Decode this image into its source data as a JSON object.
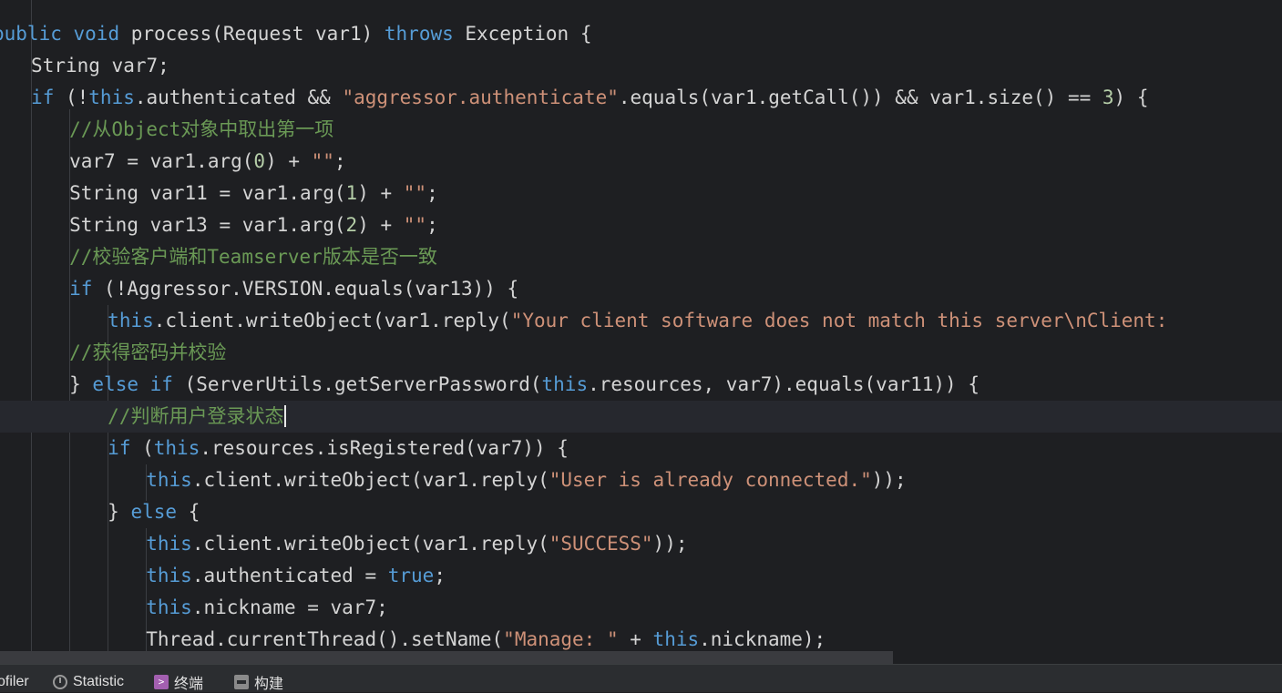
{
  "editor": {
    "lines": [
      [
        {
          "t": "public",
          "c": "kw"
        },
        {
          "t": " "
        },
        {
          "t": "void",
          "c": "kw"
        },
        {
          "t": " process(Request var1) "
        },
        {
          "t": "throws",
          "c": "kw"
        },
        {
          "t": " Exception {"
        }
      ],
      [
        {
          "t": "String var7;"
        }
      ],
      [
        {
          "t": "if",
          "c": "kw"
        },
        {
          "t": " (!"
        },
        {
          "t": "this",
          "c": "kw"
        },
        {
          "t": ".authenticated && "
        },
        {
          "t": "\"aggressor.authenticate\"",
          "c": "str"
        },
        {
          "t": ".equals(var1.getCall()) && var1.size() == "
        },
        {
          "t": "3",
          "c": "num"
        },
        {
          "t": ") {"
        }
      ],
      [
        {
          "t": "//从Object对象中取出第一项",
          "c": "cm"
        }
      ],
      [
        {
          "t": "var7 = var1.arg("
        },
        {
          "t": "0",
          "c": "num"
        },
        {
          "t": ") + "
        },
        {
          "t": "\"\"",
          "c": "str"
        },
        {
          "t": ";"
        }
      ],
      [
        {
          "t": "String var11 = var1.arg("
        },
        {
          "t": "1",
          "c": "num"
        },
        {
          "t": ") + "
        },
        {
          "t": "\"\"",
          "c": "str"
        },
        {
          "t": ";"
        }
      ],
      [
        {
          "t": "String var13 = var1.arg("
        },
        {
          "t": "2",
          "c": "num"
        },
        {
          "t": ") + "
        },
        {
          "t": "\"\"",
          "c": "str"
        },
        {
          "t": ";"
        }
      ],
      [
        {
          "t": "//校验客户端和Teamserver版本是否一致",
          "c": "cm"
        }
      ],
      [
        {
          "t": "if",
          "c": "kw"
        },
        {
          "t": " (!Aggressor.VERSION.equals(var13)) {"
        }
      ],
      [
        {
          "t": "this",
          "c": "kw"
        },
        {
          "t": ".client.writeObject(var1.reply("
        },
        {
          "t": "\"Your client software does not match this server\\nClient:",
          "c": "str"
        }
      ],
      [
        {
          "t": "//获得密码并校验",
          "c": "cm"
        }
      ],
      [
        {
          "t": "} "
        },
        {
          "t": "else",
          "c": "kw"
        },
        {
          "t": " "
        },
        {
          "t": "if",
          "c": "kw"
        },
        {
          "t": " (ServerUtils.getServerPassword("
        },
        {
          "t": "this",
          "c": "kw"
        },
        {
          "t": ".resources, var7).equals(var11)) {"
        }
      ],
      [
        {
          "t": "//判断用户登录状态",
          "c": "cm"
        }
      ],
      [
        {
          "t": "if",
          "c": "kw"
        },
        {
          "t": " ("
        },
        {
          "t": "this",
          "c": "kw"
        },
        {
          "t": ".resources.isRegistered(var7)) {"
        }
      ],
      [
        {
          "t": "this",
          "c": "kw"
        },
        {
          "t": ".client.writeObject(var1.reply("
        },
        {
          "t": "\"User is already connected.\"",
          "c": "str"
        },
        {
          "t": "));"
        }
      ],
      [
        {
          "t": "} "
        },
        {
          "t": "else",
          "c": "kw"
        },
        {
          "t": " {"
        }
      ],
      [
        {
          "t": "this",
          "c": "kw"
        },
        {
          "t": ".client.writeObject(var1.reply("
        },
        {
          "t": "\"SUCCESS\"",
          "c": "str"
        },
        {
          "t": "));"
        }
      ],
      [
        {
          "t": "this",
          "c": "kw"
        },
        {
          "t": ".authenticated = "
        },
        {
          "t": "true",
          "c": "kw"
        },
        {
          "t": ";"
        }
      ],
      [
        {
          "t": "this",
          "c": "kw"
        },
        {
          "t": ".nickname = var7;"
        }
      ],
      [
        {
          "t": "Thread.currentThread().setName("
        },
        {
          "t": "\"Manage: \"",
          "c": "str"
        },
        {
          "t": " + "
        },
        {
          "t": "this",
          "c": "kw"
        },
        {
          "t": ".nickname);"
        }
      ]
    ],
    "current_line_index": 12
  },
  "statusbar": {
    "tools": [
      {
        "label": "ofiler",
        "icon": "profiler-icon"
      },
      {
        "label": "Statistic",
        "icon": "clock-icon"
      },
      {
        "label": "终端",
        "icon": "terminal-icon"
      },
      {
        "label": "构建",
        "icon": "build-icon"
      }
    ]
  },
  "colors": {
    "background": "#1e1f22",
    "keyword": "#569cd6",
    "string": "#ce9178",
    "comment": "#6a9955",
    "number": "#b5cea8",
    "text": "#d4d4d4"
  }
}
